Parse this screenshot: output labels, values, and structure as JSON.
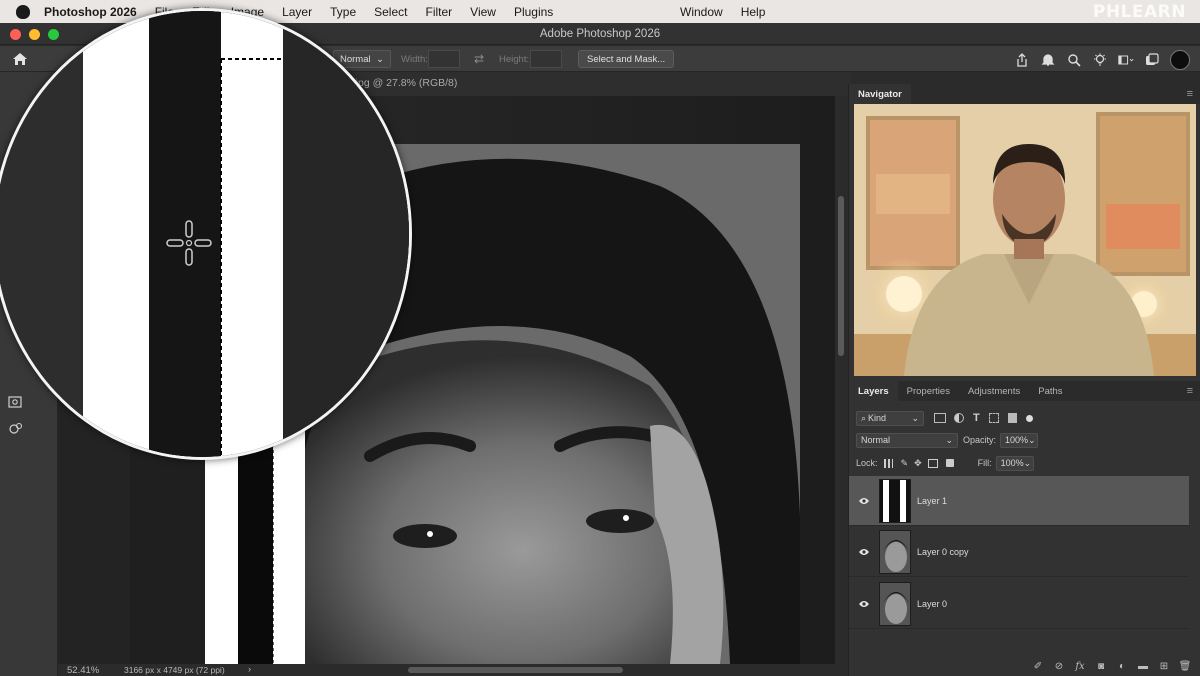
{
  "menubar": {
    "app_name": "Photoshop 2026",
    "items": [
      "File",
      "Edit",
      "Image",
      "Layer",
      "Type",
      "Select",
      "Filter",
      "View",
      "Plugins"
    ],
    "right_items": [
      "Window",
      "Help"
    ],
    "watermark": "PHLEARN"
  },
  "window": {
    "title": "Adobe Photoshop 2026"
  },
  "options_bar": {
    "style_value": "Normal",
    "width_label": "Width:",
    "height_label": "Height:",
    "select_mask_label": "Select and Mask..."
  },
  "document": {
    "tab_title": "st 02.jpg @ 27.8% (RGB/8)"
  },
  "status": {
    "zoom": "52.41%",
    "dimensions": "3166 px x 4749 px (72 ppi)"
  },
  "navigator": {
    "title": "Navigator"
  },
  "layers_panel": {
    "tabs": [
      "Layers",
      "Properties",
      "Adjustments",
      "Paths"
    ],
    "filter_kind": "Kind",
    "blend_mode": "Normal",
    "opacity_label": "Opacity:",
    "opacity_value": "100%",
    "lock_label": "Lock:",
    "fill_label": "Fill:",
    "fill_value": "100%",
    "layers": [
      {
        "name": "Layer 1",
        "selected": true
      },
      {
        "name": "Layer 0 copy",
        "selected": false
      },
      {
        "name": "Layer 0",
        "selected": false
      }
    ]
  },
  "icons": {
    "toolbar": [
      "home-icon",
      "marquee-tool-icon"
    ],
    "top_right": [
      "share-icon",
      "bell-icon",
      "search-icon",
      "lightbulb-icon",
      "workspace-icon",
      "cloud-docs-icon",
      "avatar"
    ],
    "layers_footer": [
      "brush-icon",
      "link-icon",
      "fx-icon",
      "mask-icon",
      "adjustment-icon",
      "folder-icon",
      "new-layer-icon",
      "trash-icon"
    ]
  },
  "colors": {
    "menubar_bg": "#e9e6e3",
    "panel_bg": "#323232",
    "selected_layer": "#575757",
    "loupe_border": "#f4f4f4",
    "traffic_red": "#ff5f57",
    "traffic_yellow": "#febc2e",
    "traffic_green": "#28c840"
  }
}
